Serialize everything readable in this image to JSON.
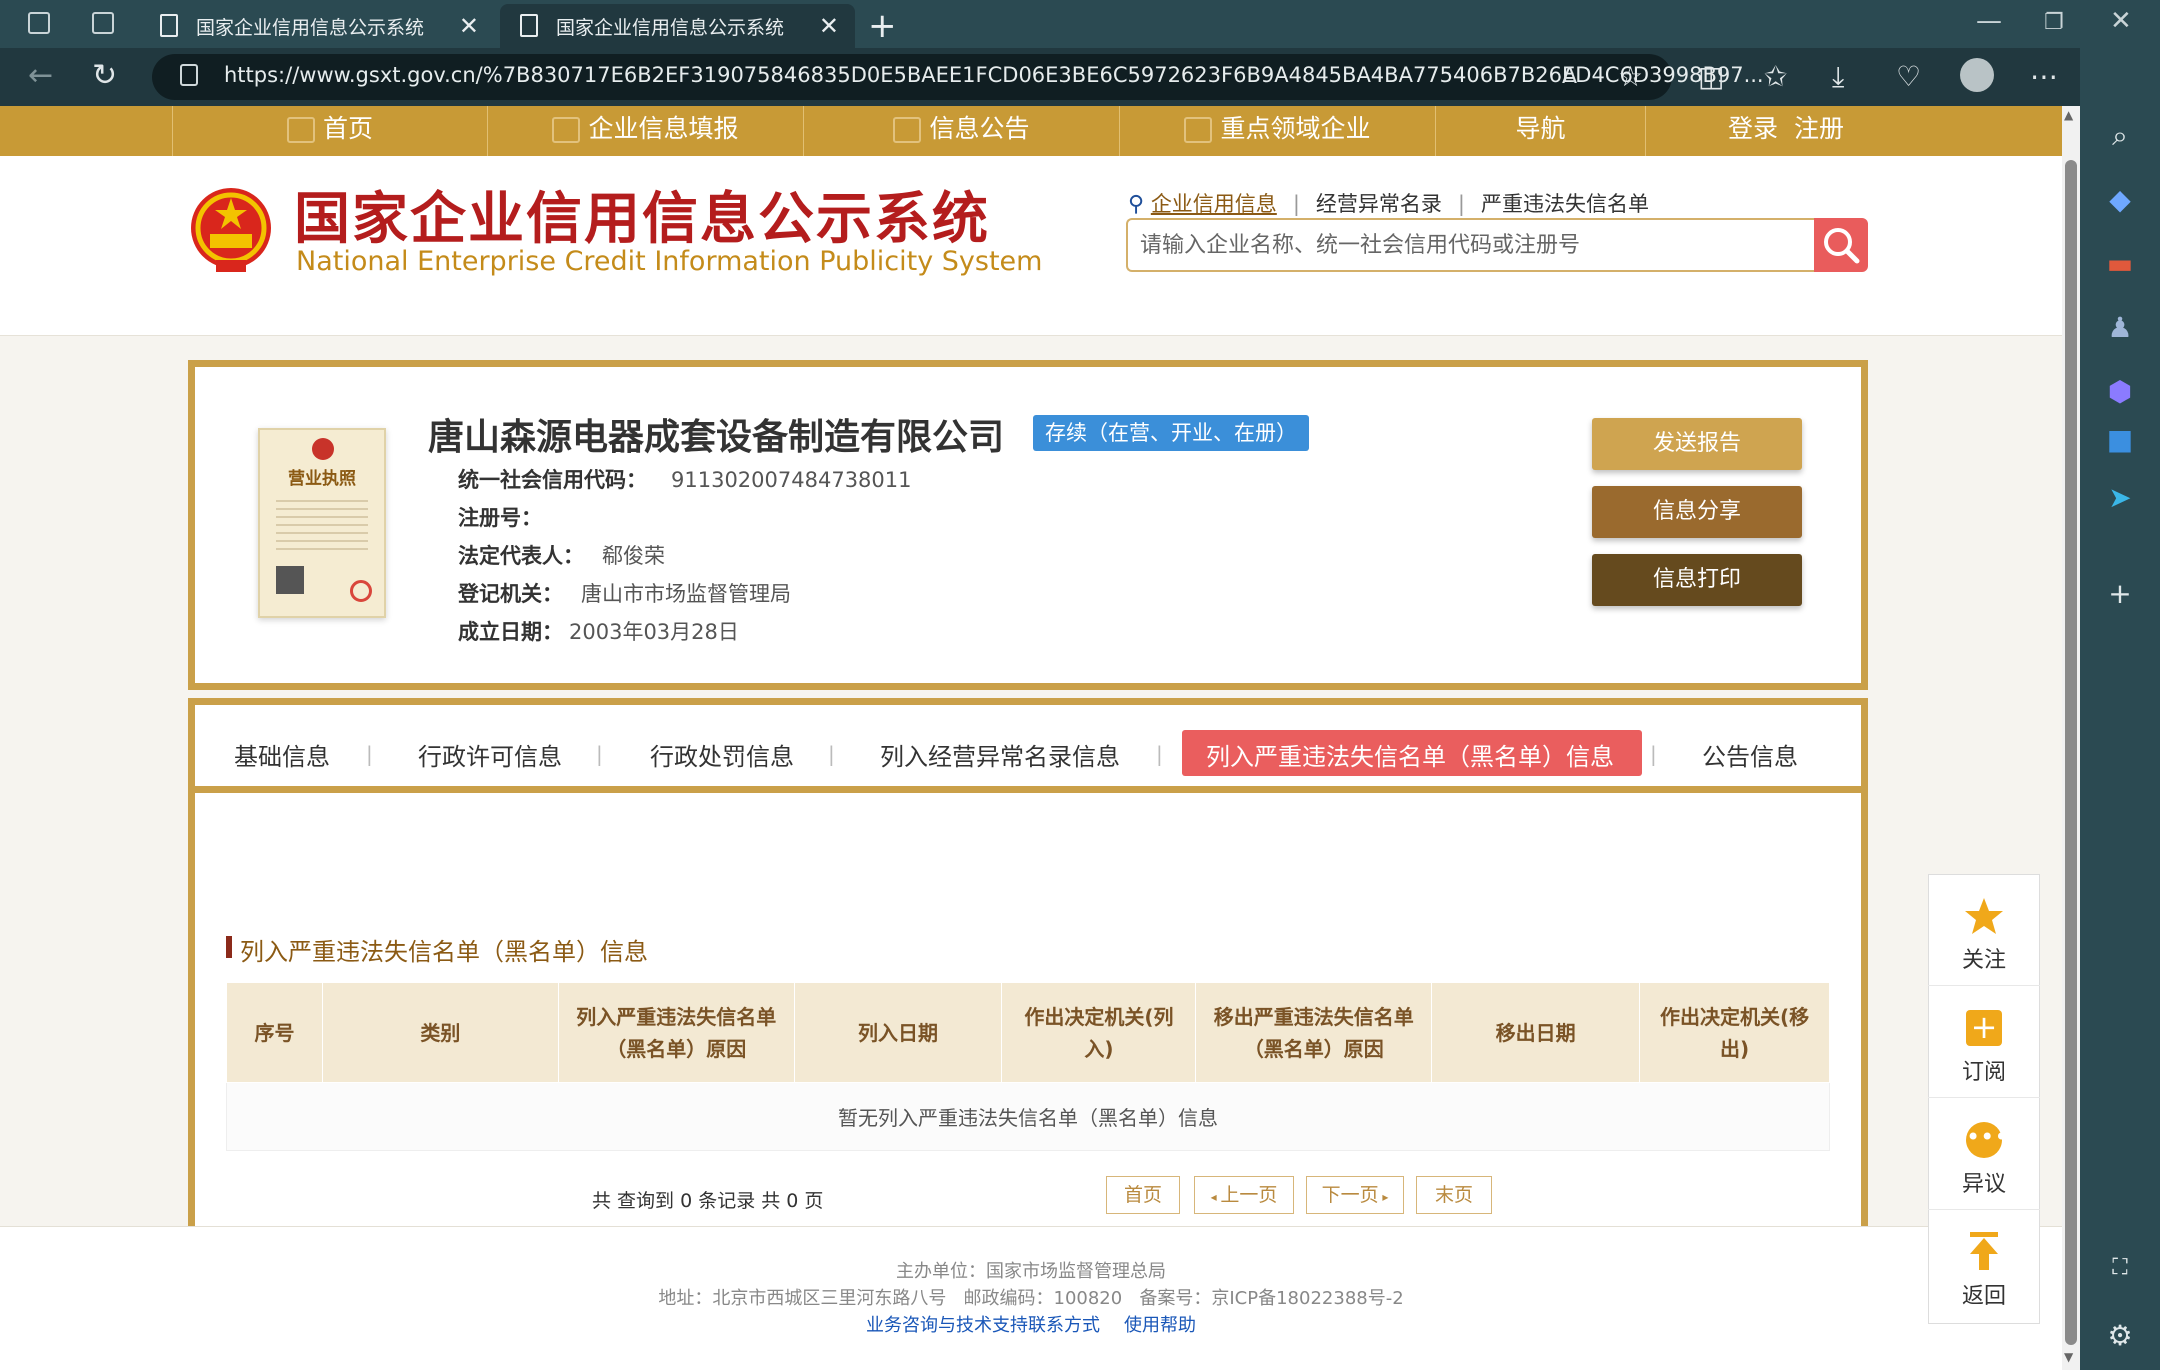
{
  "browser": {
    "tabs": [
      {
        "title": "国家企业信用信息公示系统",
        "active": false
      },
      {
        "title": "国家企业信用信息公示系统",
        "active": true
      }
    ],
    "url": "https://www.gsxt.gov.cn/%7B830717E6B2EF319075846835D0E5BAEE1FCD06E3BE6C5972623F6B9A4845BA4BA775406B7B26ED4C6D3998B97..."
  },
  "topnav": {
    "items": [
      {
        "label": "首页",
        "icon": "monitor-icon"
      },
      {
        "label": "企业信息填报",
        "icon": "edit-icon"
      },
      {
        "label": "信息公告",
        "icon": "document-icon"
      },
      {
        "label": "重点领域企业",
        "icon": "megaphone-icon"
      },
      {
        "label": "导航",
        "icon": ""
      },
      {
        "label": "登录  注册",
        "icon": ""
      }
    ]
  },
  "header": {
    "title": "国家企业信用信息公示系统",
    "subtitle": "National Enterprise Credit Information Publicity System",
    "search_links": [
      "企业信用信息",
      "经营异常名录",
      "严重违法失信名单"
    ],
    "search_placeholder": "请输入企业名称、统一社会信用代码或注册号"
  },
  "company": {
    "name": "唐山森源电器成套设备制造有限公司",
    "status": "存续（在营、开业、在册）",
    "fields": [
      {
        "label": "统一社会信用代码：",
        "value": "911302007484738011"
      },
      {
        "label": "注册号：",
        "value": ""
      },
      {
        "label": "法定代表人：",
        "value": "郗俊荣"
      },
      {
        "label": "登记机关：",
        "value": "唐山市市场监督管理局"
      },
      {
        "label": "成立日期：",
        "value": "2003年03月28日"
      }
    ],
    "license_label": "营业执照",
    "actions": {
      "send_report": "发送报告",
      "share": "信息分享",
      "print": "信息打印"
    }
  },
  "tabs": [
    "基础信息",
    "行政许可信息",
    "行政处罚信息",
    "列入经营异常名录信息",
    "列入严重违法失信名单（黑名单）信息",
    "公告信息"
  ],
  "section": {
    "title": "列入严重违法失信名单（黑名单）信息",
    "columns": [
      "序号",
      "类别",
      "列入严重违法失信名单（黑名单）原因",
      "列入日期",
      "作出决定机关(列入)",
      "移出严重违法失信名单（黑名单）原因",
      "移出日期",
      "作出决定机关(移出)"
    ],
    "empty_text": "暂无列入严重违法失信名单（黑名单）信息"
  },
  "pager": {
    "summary": "共 查询到 0 条记录 共 0 页",
    "first": "首页",
    "prev": "上一页",
    "next": "下一页",
    "last": "末页"
  },
  "float_bar": {
    "follow": "关注",
    "subscribe": "订阅",
    "objection": "异议",
    "back": "返回"
  },
  "footer": {
    "sponsor": "主办单位：国家市场监督管理总局",
    "address": "地址：北京市西城区三里河东路八号   邮政编码：100820   备案号：京ICP备18022388号-2",
    "link_contact": "业务咨询与技术支持联系方式",
    "link_help": "使用帮助"
  },
  "colors": {
    "gold": "#C89A36",
    "red_tab": "#EA5E5E",
    "status_blue": "#3B8FD9",
    "btn1": "#CFA450",
    "btn2": "#9A6A2E",
    "btn3": "#654A1E"
  }
}
